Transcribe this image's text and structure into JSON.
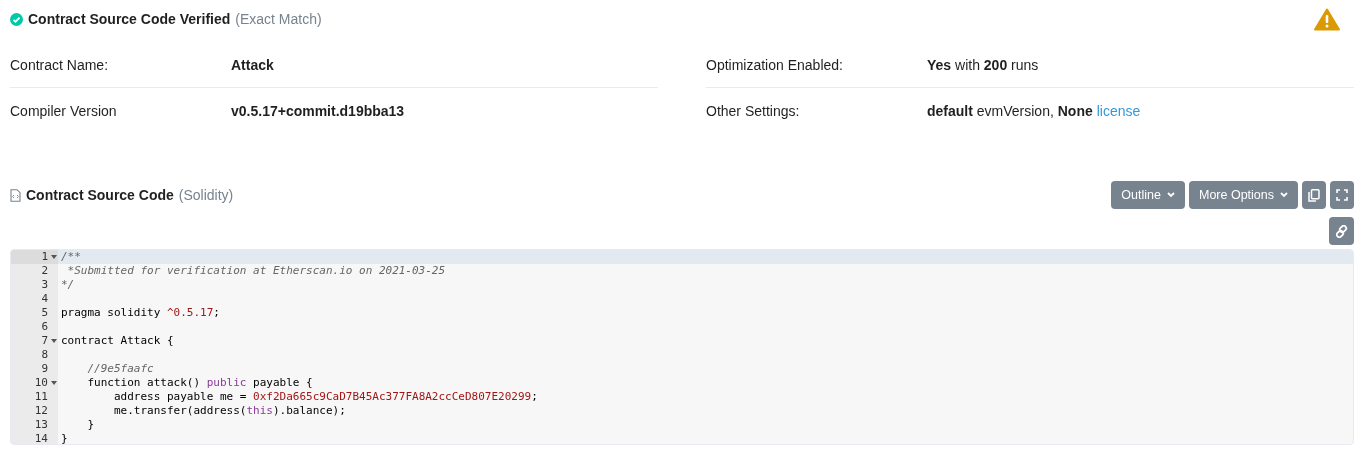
{
  "verified": {
    "title": "Contract Source Code Verified",
    "note": "(Exact Match)"
  },
  "details": [
    {
      "label": "Contract Name:",
      "value": "**Attack**"
    },
    {
      "label": "Optimization Enabled:",
      "value": "**Yes** with **200** runs"
    },
    {
      "label": "Compiler Version",
      "value": "**v0.5.17+commit.d19bba13**"
    },
    {
      "label": "Other Settings:",
      "value": "**default** evmVersion, **None**",
      "link": "license"
    }
  ],
  "source": {
    "title": "Contract Source Code",
    "language": "(Solidity)"
  },
  "buttons": [
    {
      "label": "Outline",
      "kind": "dropdown"
    },
    {
      "label": "More Options",
      "kind": "dropdown"
    },
    {
      "kind": "copy"
    },
    {
      "kind": "fullscreen"
    }
  ],
  "link_button": {
    "kind": "link"
  },
  "code": [
    {
      "number": "1",
      "fold": true,
      "active": true,
      "segments": [
        {
          "text": "/**",
          "kind": "comment"
        }
      ]
    },
    {
      "number": "2",
      "fold": false,
      "active": false,
      "segments": [
        {
          "text": " *Submitted for verification at Etherscan.io on 2021-03-25",
          "kind": "comment"
        }
      ]
    },
    {
      "number": "3",
      "fold": false,
      "active": false,
      "segments": [
        {
          "text": "*/",
          "kind": "comment"
        }
      ]
    },
    {
      "number": "4",
      "fold": false,
      "active": false
    },
    {
      "number": "5",
      "fold": false,
      "active": false,
      "segments": [
        {
          "text": "pragma solidity ",
          "kind": "plain"
        },
        {
          "text": "^0.5.17",
          "kind": "number"
        },
        {
          "text": ";",
          "kind": "plain"
        }
      ]
    },
    {
      "number": "6",
      "fold": false,
      "active": false
    },
    {
      "number": "7",
      "fold": true,
      "active": false,
      "segments": [
        {
          "text": "contract Attack {",
          "kind": "plain"
        }
      ]
    },
    {
      "number": "8",
      "fold": false,
      "active": false
    },
    {
      "number": "9",
      "fold": false,
      "active": false,
      "segments": [
        {
          "text": "    //9e5faafc",
          "kind": "comment"
        }
      ]
    },
    {
      "number": "10",
      "fold": true,
      "active": false,
      "segments": [
        {
          "text": "    function attack() ",
          "kind": "plain"
        },
        {
          "text": "public",
          "kind": "keyword"
        },
        {
          "text": " payable {",
          "kind": "plain"
        }
      ]
    },
    {
      "number": "11",
      "fold": false,
      "active": false,
      "segments": [
        {
          "text": "        address payable me = ",
          "kind": "plain"
        },
        {
          "text": "0xf2Da665c9CaD7B45Ac377FA8A2ccCeD807E20299",
          "kind": "number"
        },
        {
          "text": ";",
          "kind": "plain"
        }
      ]
    },
    {
      "number": "12",
      "fold": false,
      "active": false,
      "segments": [
        {
          "text": "        me.transfer(address(",
          "kind": "plain"
        },
        {
          "text": "this",
          "kind": "keyword"
        },
        {
          "text": ").balance);",
          "kind": "plain"
        }
      ]
    },
    {
      "number": "13",
      "fold": false,
      "active": false,
      "segments": [
        {
          "text": "    }",
          "kind": "plain"
        }
      ]
    },
    {
      "number": "14",
      "fold": false,
      "active": false,
      "segments": [
        {
          "text": "}",
          "kind": "plain"
        }
      ]
    }
  ]
}
